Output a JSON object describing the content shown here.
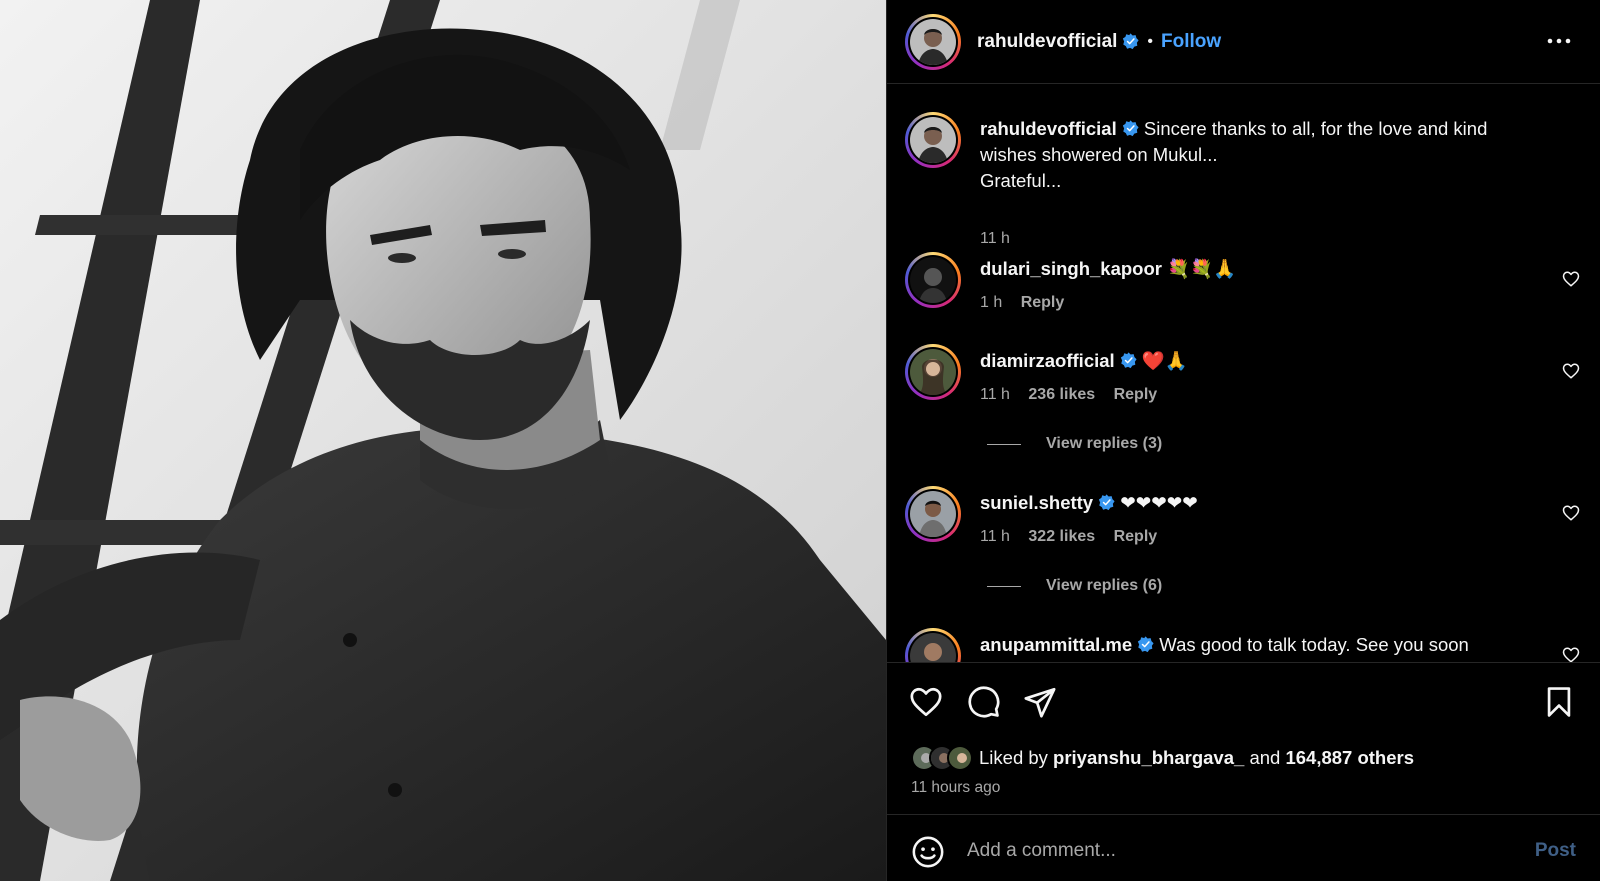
{
  "post": {
    "author": "rahuldevofficial",
    "follow_label": "Follow",
    "separator": "•",
    "caption_line1": "Sincere thanks to all, for the love and kind",
    "caption_line2": "wishes showered on Mukul...",
    "caption_line3": "Grateful...",
    "caption_time": "11 h"
  },
  "comments": [
    {
      "user": "dulari_singh_kapoor",
      "text": "💐💐🙏",
      "time": "1 h",
      "likes": "",
      "reply": "Reply",
      "verified": false
    },
    {
      "user": "diamirzaofficial",
      "text": "❤️🙏",
      "time": "11 h",
      "likes": "236 likes",
      "reply": "Reply",
      "verified": true,
      "view_replies": "View replies (3)"
    },
    {
      "user": "suniel.shetty",
      "text": "❤❤❤❤❤",
      "time": "11 h",
      "likes": "322 likes",
      "reply": "Reply",
      "verified": true,
      "view_replies": "View replies (6)"
    },
    {
      "user": "anupammittal.me",
      "text": "Was good to talk today. See you soon",
      "verified": true
    }
  ],
  "likes_summary": {
    "prefix": "Liked by",
    "user": "priyanshu_bhargava_",
    "middle": "and",
    "others": "164,887 others"
  },
  "posted_ago": "11 hours ago",
  "composer": {
    "placeholder": "Add a comment...",
    "post_label": "Post"
  },
  "icons": {
    "like": "heart-icon",
    "comment": "comment-icon",
    "share": "share-icon",
    "save": "bookmark-icon",
    "emoji": "emoji-icon",
    "more": "more-options-icon"
  },
  "colors": {
    "accent": "#4aa3ff",
    "verified": "#3897f0",
    "muted": "#a8a8a8",
    "background": "#000000"
  }
}
